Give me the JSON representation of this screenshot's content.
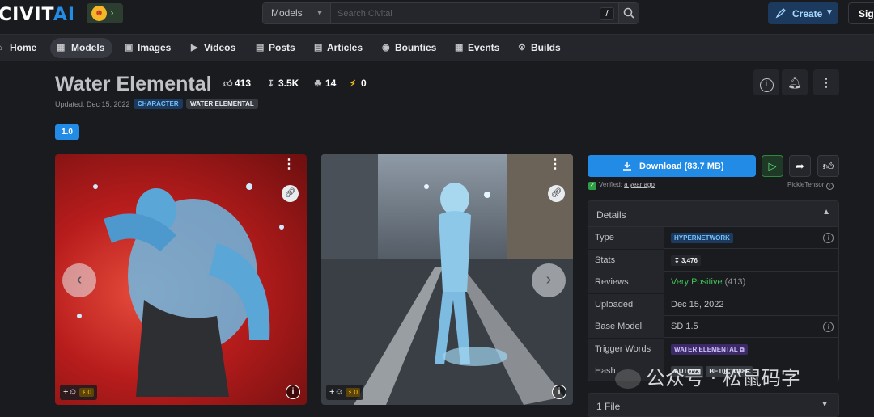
{
  "brand": {
    "logo_main": "CIVIT",
    "logo_ai": "AI"
  },
  "search": {
    "scope": "Models",
    "placeholder": "Search Civitai",
    "shortcut": "/"
  },
  "header": {
    "create_label": "Create",
    "signin_label": "Sign"
  },
  "nav": [
    {
      "label": "Home",
      "icon": "home-icon"
    },
    {
      "label": "Models",
      "icon": "grid-icon"
    },
    {
      "label": "Images",
      "icon": "image-icon"
    },
    {
      "label": "Videos",
      "icon": "video-icon"
    },
    {
      "label": "Posts",
      "icon": "posts-icon"
    },
    {
      "label": "Articles",
      "icon": "article-icon"
    },
    {
      "label": "Bounties",
      "icon": "bounty-icon"
    },
    {
      "label": "Events",
      "icon": "calendar-icon"
    },
    {
      "label": "Builds",
      "icon": "builds-icon"
    }
  ],
  "model": {
    "title": "Water Elemental",
    "likes": "413",
    "downloads": "3.5K",
    "bookmarks": "14",
    "buzz": "0",
    "updated": "Updated: Dec 15, 2022",
    "tags": [
      "CHARACTER",
      "WATER ELEMENTAL"
    ],
    "version": "1.0"
  },
  "gallery": [
    {
      "buzz": "0"
    },
    {
      "buzz": "0"
    }
  ],
  "download": {
    "label": "Download (83.7 MB)",
    "verified_prefix": "Verified:",
    "verified_when": "a year ago",
    "scanner": "PickleTensor"
  },
  "details": {
    "heading": "Details",
    "rows": {
      "type": {
        "label": "Type",
        "value": "HYPERNETWORK"
      },
      "stats": {
        "label": "Stats",
        "value": "3,476"
      },
      "reviews": {
        "label": "Reviews",
        "value": "Very Positive",
        "count": "(413)"
      },
      "uploaded": {
        "label": "Uploaded",
        "value": "Dec 15, 2022"
      },
      "base_model": {
        "label": "Base Model",
        "value": "SD 1.5"
      },
      "trigger": {
        "label": "Trigger Words",
        "value": "WATER ELEMENTAL"
      },
      "hash": {
        "label": "Hash",
        "algo": "AUTOV2",
        "value": "BE10C1C88F"
      }
    }
  },
  "files": {
    "label": "1 File"
  },
  "watermark": {
    "text": "公众号 · 松鼠码字"
  },
  "colors": {
    "accent": "#228be6",
    "background": "#1a1b1e",
    "positive": "#40c057"
  }
}
